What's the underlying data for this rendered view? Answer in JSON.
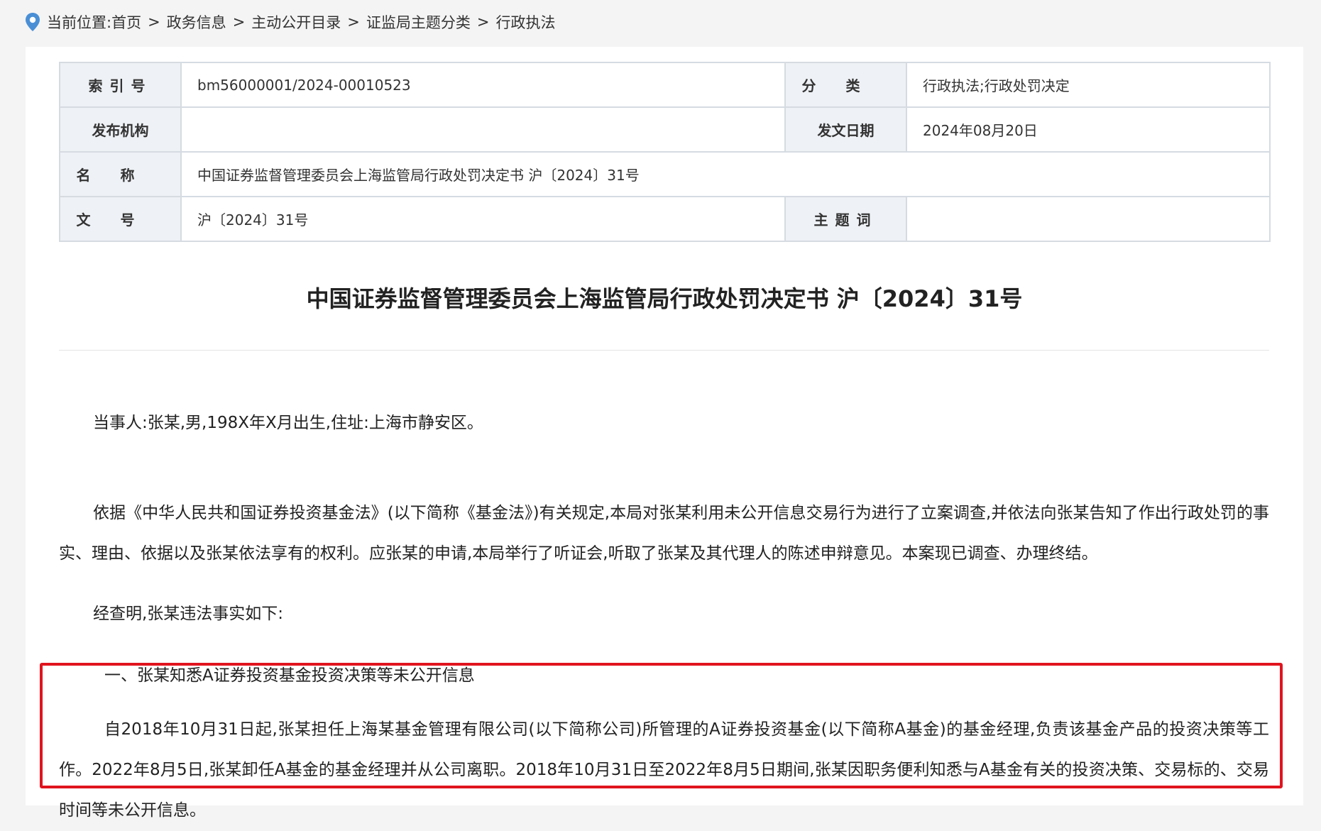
{
  "breadcrumb": {
    "prefix": "当前位置:",
    "items": [
      "首页",
      "政务信息",
      "主动公开目录",
      "证监局主题分类",
      "行政执法"
    ],
    "separator": ">"
  },
  "meta": {
    "index_label": "索引号",
    "index_value": "bm56000001/2024-00010523",
    "category_label": "分类",
    "category_value": "行政执法;行政处罚决定",
    "issuer_label": "发布机构",
    "issuer_value": "",
    "date_label": "发文日期",
    "date_value": "2024年08月20日",
    "name_label": "名称",
    "name_value": "中国证券监督管理委员会上海监管局行政处罚决定书 沪〔2024〕31号",
    "docno_label": "文号",
    "docno_value": "沪〔2024〕31号",
    "keywords_label": "主题词",
    "keywords_value": ""
  },
  "document": {
    "title": "中国证券监督管理委员会上海监管局行政处罚决定书 沪〔2024〕31号",
    "p1": "当事人:张某,男,198X年X月出生,住址:上海市静安区。",
    "p2": "依据《中华人民共和国证券投资基金法》(以下简称《基金法》)有关规定,本局对张某利用未公开信息交易行为进行了立案调查,并依法向张某告知了作出行政处罚的事实、理由、依据以及张某依法享有的权利。应张某的申请,本局举行了听证会,听取了张某及其代理人的陈述申辩意见。本案现已调查、办理终结。",
    "p3": "经查明,张某违法事实如下:",
    "section1": "一、张某知悉A证券投资基金投资决策等未公开信息",
    "p4": "自2018年10月31日起,张某担任上海某基金管理有限公司(以下简称公司)所管理的A证券投资基金(以下简称A基金)的基金经理,负责该基金产品的投资决策等工作。2022年8月5日,张某卸任A基金的基金经理并从公司离职。2018年10月31日至2022年8月5日期间,张某因职务便利知悉与A基金有关的投资决策、交易标的、交易时间等未公开信息。"
  },
  "colors": {
    "highlight_border": "#e0141e",
    "label_bg": "#eef1f5",
    "page_bg": "#f4f4f4",
    "pin_icon": "#4a8fd6"
  },
  "icons": {
    "location": "location-pin-icon"
  }
}
